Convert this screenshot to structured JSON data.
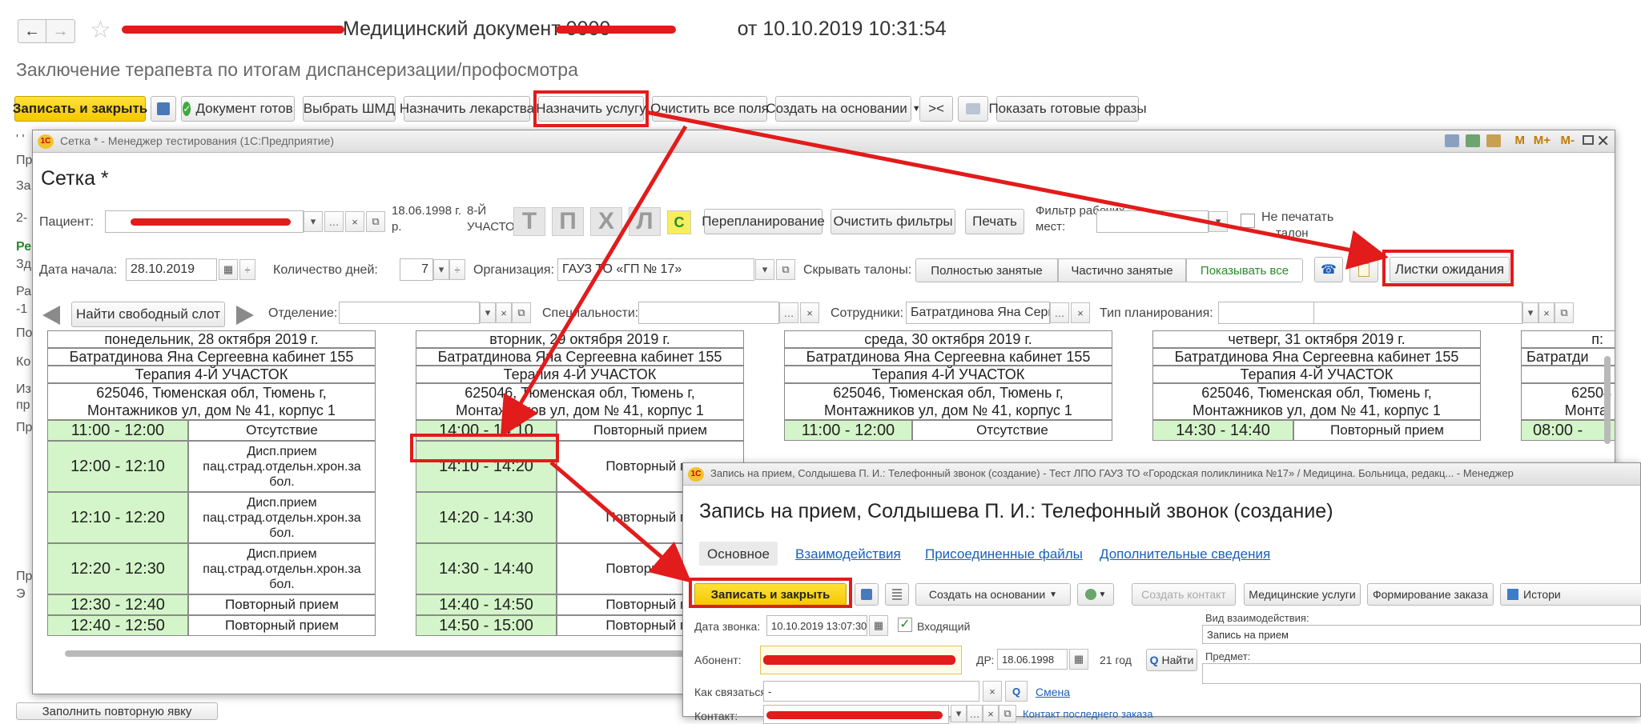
{
  "main_window": {
    "title_suffix": "Медицинский документ 0000-",
    "title_tail": "от 10.10.2019 10:31:54",
    "subtitle": "Заключение терапевта по итогам диспансеризации/профосмотра",
    "toolbar": [
      "Записать и закрыть",
      "Документ готов",
      "Выбрать ШМД",
      "Назначить лекарства",
      "Назначить услугу",
      "Очистить все поля",
      "Создать на основании",
      "><",
      "Показать готовые фразы"
    ],
    "left_fragments": [
      "' '",
      "Пр",
      "За",
      "2-",
      "Ре",
      "Зд",
      "Ра",
      "-1",
      "По",
      "Ко",
      "Из",
      "пр",
      "Пр",
      "Пр",
      "Э"
    ],
    "bottom_button": "Заполнить повторную явку"
  },
  "setka": {
    "titlebar": "Сетка * - Менеджер тестирования (1С:Предприятие)",
    "titlebar_buttons": [
      "M",
      "M+",
      "M-"
    ],
    "heading": "Сетка *",
    "patient_label": "Пациент:",
    "dob": "18.06.1998 г.",
    "dob_suffix": "р.",
    "uchastok": "8-Й",
    "uchastok2": "УЧАСТОК",
    "plan_buttons": [
      "Т",
      "П",
      "Х",
      "Л",
      "С"
    ],
    "replan_button": "Перепланирование",
    "clear_filters": "Очистить фильтры",
    "print": "Печать",
    "filter_label": "Фильтр рабочих",
    "filter_label2": "мест:",
    "no_print": "Не печатать",
    "no_print2": "талон",
    "start_label": "Дата начала:",
    "start_date": "28.10.2019",
    "days_label": "Количество дней:",
    "days_value": "7",
    "org_label": "Организация:",
    "org_value": "ГАУЗ ТО «ГП № 17»",
    "hide_label": "Скрывать талоны:",
    "hide_opts": [
      "Полностью занятые",
      "Частично занятые",
      "Показывать все"
    ],
    "waiting_lists": "Листки ожидания",
    "find_slot": "Найти свободный слот",
    "dept_label": "Отделение:",
    "spec_label": "Специальности:",
    "staff_label": "Сотрудники:",
    "staff_value": "Батратдинова Яна Сергее",
    "plan_type_label": "Тип планирования:",
    "days": [
      {
        "date": "понедельник, 28 октября 2019 г.",
        "doctor": "Батратдинова Яна Сергеевна кабинет 155",
        "spec": "Терапия 4-Й УЧАСТОК",
        "addr1": "625046, Тюменская обл, Тюмень г,",
        "addr2": "Монтажников ул, дом № 41, корпус 1",
        "slots": [
          {
            "time": "11:00 - 12:00",
            "status": "Отсутствие"
          },
          {
            "time": "12:00 - 12:10",
            "status": "Дисп.прием пац.страд.отдельн.хрон.за бол."
          },
          {
            "time": "12:10 - 12:20",
            "status": "Дисп.прием пац.страд.отдельн.хрон.за бол."
          },
          {
            "time": "12:20 - 12:30",
            "status": "Дисп.прием пац.страд.отдельн.хрон.за бол."
          },
          {
            "time": "12:30 - 12:40",
            "status": "Повторный прием"
          },
          {
            "time": "12:40 - 12:50",
            "status": "Повторный прием"
          }
        ]
      },
      {
        "date": "вторник, 29 октября 2019 г.",
        "doctor": "Батратдинова Яна Сергеевна кабинет 155",
        "spec": "Терапия 4-Й УЧАСТОК",
        "addr1": "625046, Тюменская обл, Тюмень г,",
        "addr2": "Монтажников ул, дом № 41, корпус 1",
        "slots": [
          {
            "time": "14:00 - 14:10",
            "status": "Повторный прием"
          },
          {
            "time": "14:10 - 14:20",
            "status": "Повторный пр"
          },
          {
            "time": "14:20 - 14:30",
            "status": "Повторный пр"
          },
          {
            "time": "14:30 - 14:40",
            "status": "Повторный пр"
          },
          {
            "time": "14:40 - 14:50",
            "status": "Повторный пр"
          },
          {
            "time": "14:50 - 15:00",
            "status": "Повторный пр"
          }
        ]
      },
      {
        "date": "среда, 30 октября 2019 г.",
        "doctor": "Батратдинова Яна Сергеевна кабинет 155",
        "spec": "Терапия 4-Й УЧАСТОК",
        "addr1": "625046, Тюменская обл, Тюмень г,",
        "addr2": "Монтажников ул, дом № 41, корпус 1",
        "slots": [
          {
            "time": "11:00 - 12:00",
            "status": "Отсутствие"
          }
        ]
      },
      {
        "date": "четверг, 31 октября 2019 г.",
        "doctor": "Батратдинова Яна Сергеевна кабинет 155",
        "spec": "Терапия 4-Й УЧАСТОК",
        "addr1": "625046, Тюменская обл, Тюмень г,",
        "addr2": "Монтажников ул, дом № 41, корпус 1",
        "slots": [
          {
            "time": "14:30 - 14:40",
            "status": "Повторный прием"
          }
        ]
      },
      {
        "date": "п:",
        "doctor": "Батратди",
        "addr1": "62504",
        "addr2": "Монта:",
        "slot_time": "08:00 -"
      }
    ]
  },
  "zapis": {
    "titlebar": "Запись на прием, Солдышева П. И.: Телефонный звонок (создание) - Тест ЛПО ГАУЗ ТО «Городская поликлиника №17» / Медицина. Больница, редакц... - Менеджер",
    "heading": "Запись на прием, Солдышева П. И.: Телефонный звонок (создание)",
    "tabs": [
      "Основное",
      "Взаимодействия",
      "Присоединенные файлы",
      "Дополнительные сведения"
    ],
    "toolbar": [
      "Записать и закрыть",
      "Создать на основании",
      "Создать контакт",
      "Медицинские услуги",
      "Формирование заказа",
      "Истори"
    ],
    "call_date_label": "Дата звонка:",
    "call_date": "10.10.2019 13:07:30",
    "incoming": "Входящий",
    "abonent_label": "Абонент:",
    "dr_label": "ДР:",
    "dr_value": "18.06.1998",
    "age": "21 год",
    "find": "Найти",
    "how_label": "Как связаться:",
    "how_value": "-",
    "change": "Смена",
    "contact_label": "Контакт:",
    "last_order": "Контакт последнего заказа",
    "type_label": "Вид взаимодействия:",
    "type_value": "Запись на прием",
    "subject_label": "Предмет:"
  }
}
